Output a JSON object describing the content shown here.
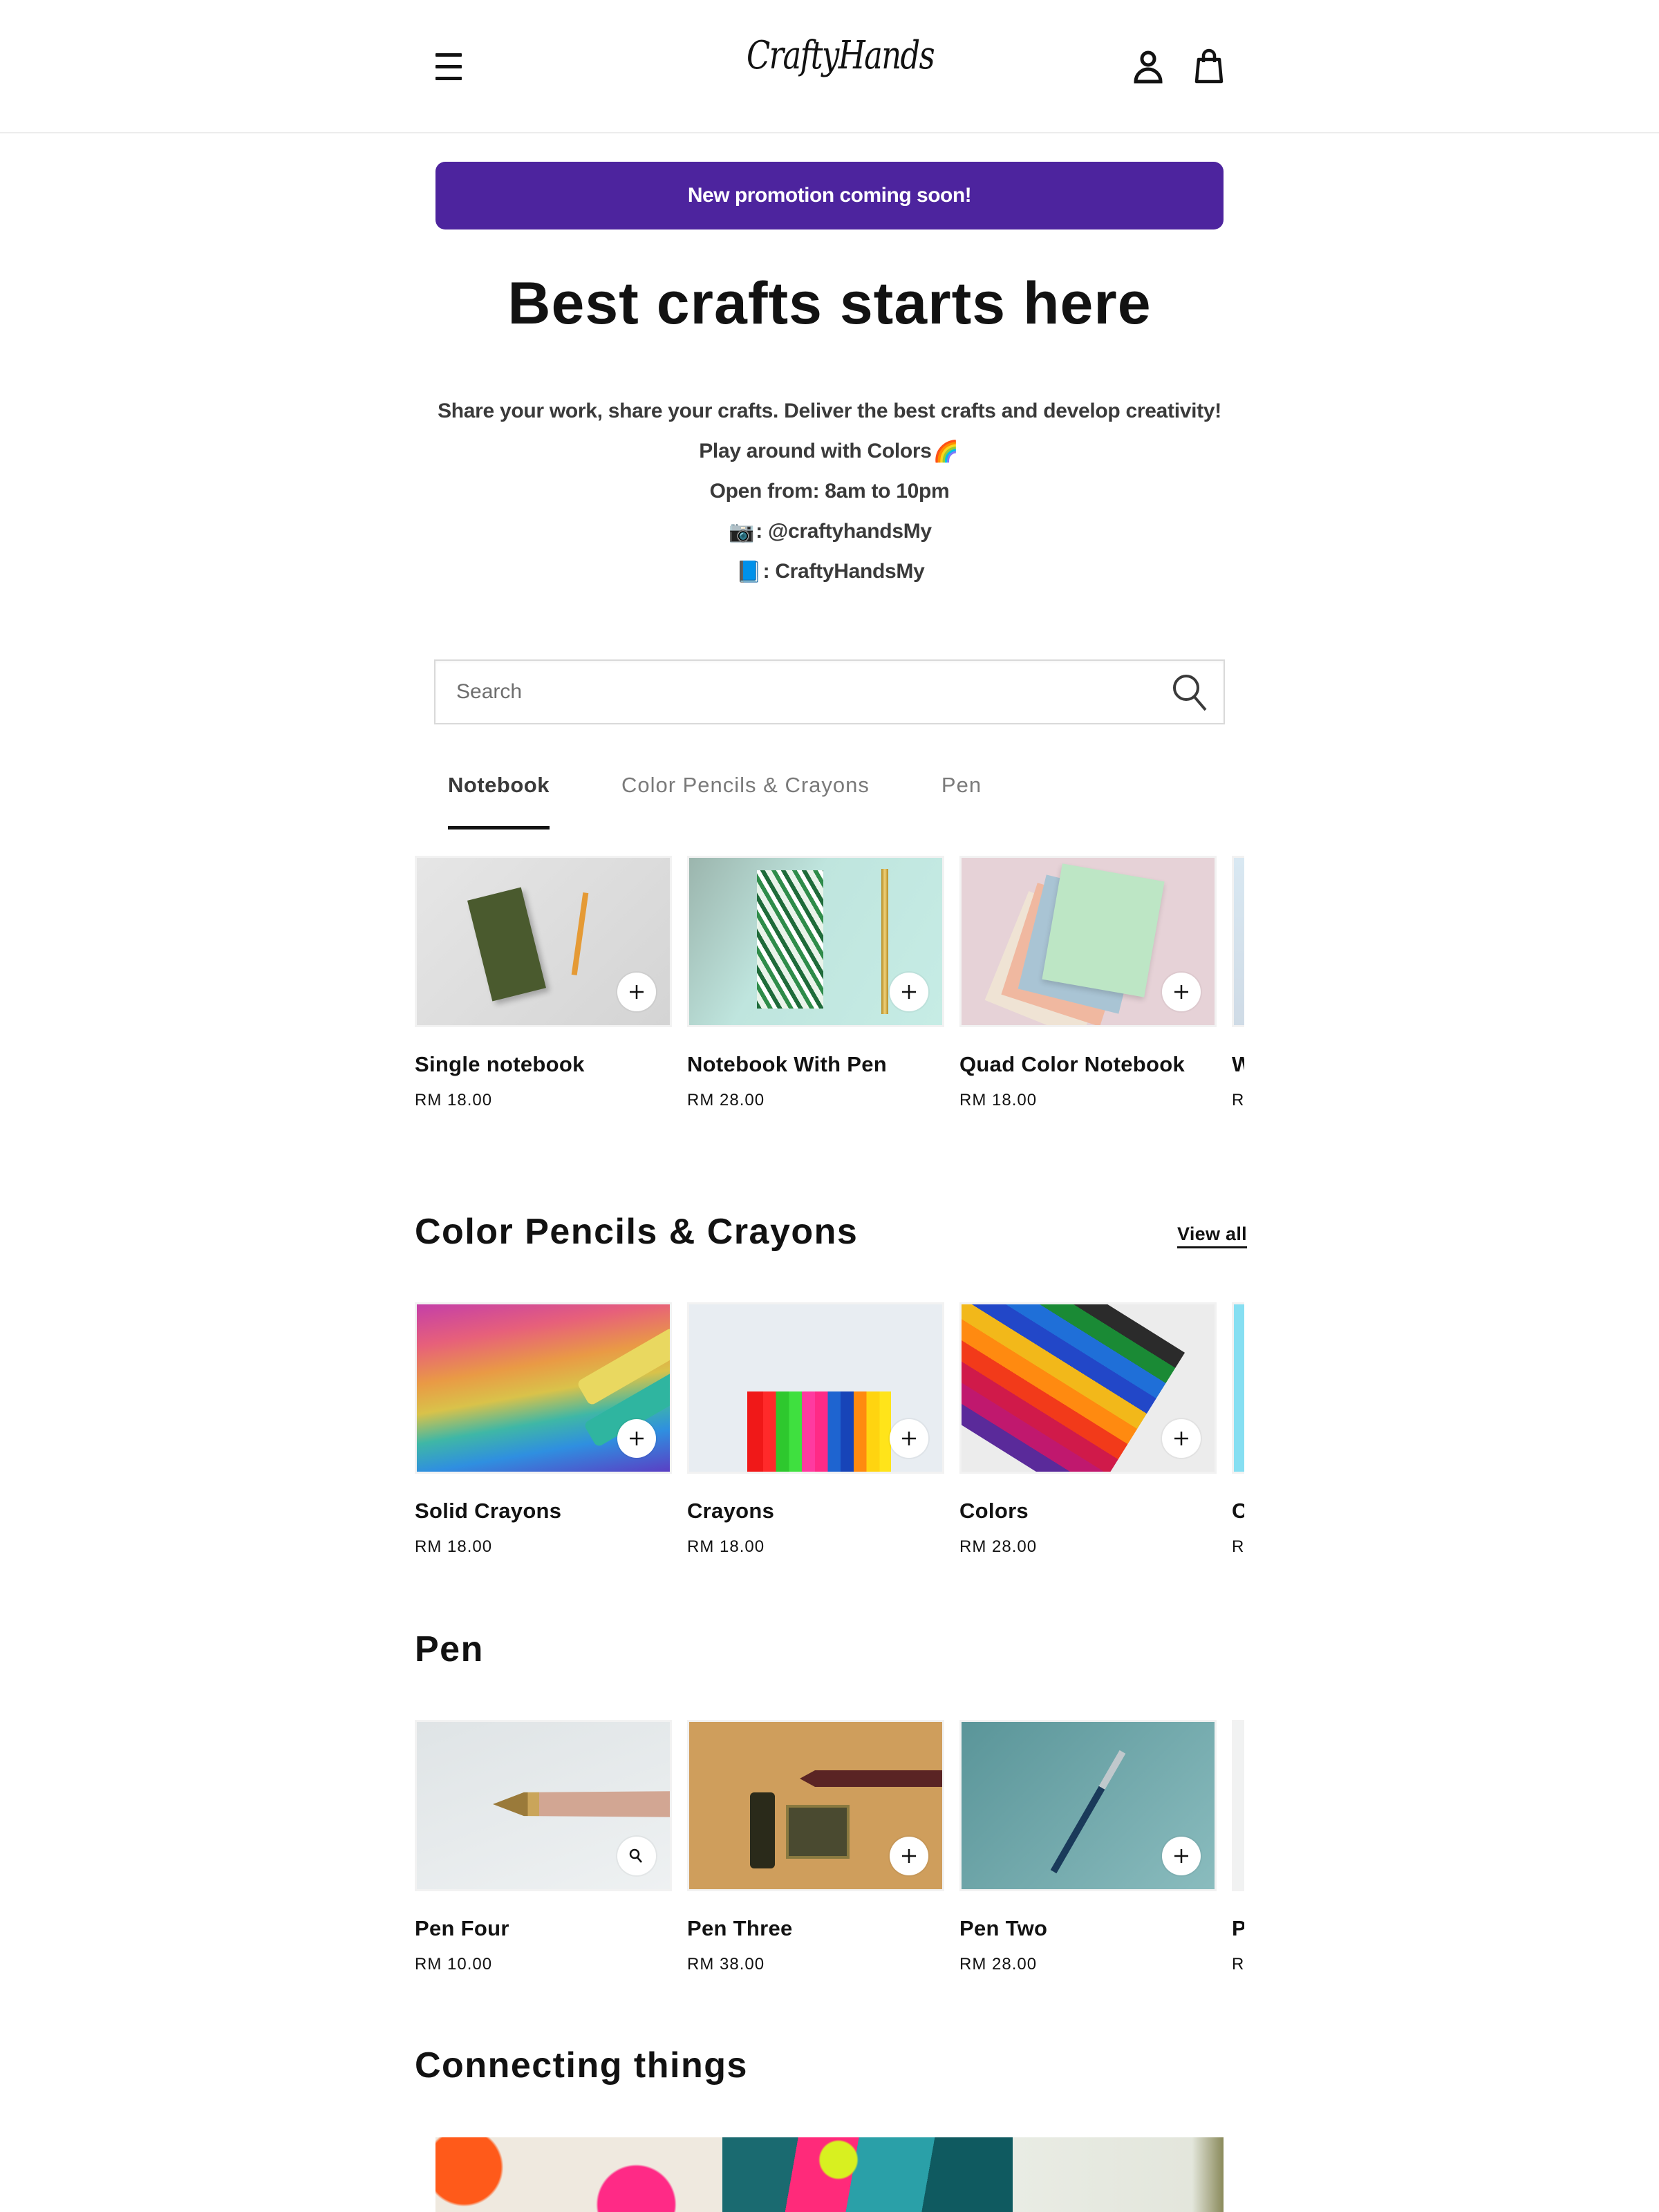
{
  "header": {
    "logo": "CraftyHands",
    "icons": [
      "menu-icon",
      "account-icon",
      "cart-icon"
    ]
  },
  "promo": {
    "text": "New promotion coming soon!",
    "color": "#4d249e"
  },
  "hero": {
    "title": "Best crafts starts here",
    "lines": [
      "Share your work, share your crafts. Deliver the best crafts and develop creativity!",
      "Play around with Colors",
      "Open from: 8am to 10pm",
      ": @craftyhandsMy",
      ": CraftyHandsMy"
    ],
    "emoji": {
      "rainbow": "🌈",
      "camera": "📷",
      "book": "📘"
    }
  },
  "search": {
    "placeholder": "Search",
    "value": ""
  },
  "tabs": [
    {
      "label": "Notebook",
      "active": true
    },
    {
      "label": "Color Pencils & Crayons",
      "active": false
    },
    {
      "label": "Pen",
      "active": false
    }
  ],
  "notebook": {
    "products": [
      {
        "title": "Single notebook",
        "price": "RM 18.00",
        "action": "add"
      },
      {
        "title": "Notebook With Pen",
        "price": "RM 28.00",
        "action": "add"
      },
      {
        "title": "Quad Color Notebook",
        "price": "RM 18.00",
        "action": "add"
      },
      {
        "title": "W",
        "price": "RI",
        "action": "add"
      }
    ]
  },
  "crayons": {
    "title": "Color Pencils & Crayons",
    "view_all": "View all",
    "products": [
      {
        "title": "Solid Crayons",
        "price": "RM 18.00",
        "action": "add"
      },
      {
        "title": "Crayons",
        "price": "RM 18.00",
        "action": "add"
      },
      {
        "title": "Colors",
        "price": "RM 28.00",
        "action": "add"
      },
      {
        "title": "C",
        "price": "RI",
        "action": "add"
      }
    ]
  },
  "pen": {
    "title": "Pen",
    "products": [
      {
        "title": "Pen Four",
        "price": "RM 10.00",
        "action": "view"
      },
      {
        "title": "Pen Three",
        "price": "RM 38.00",
        "action": "add"
      },
      {
        "title": "Pen Two",
        "price": "RM 28.00",
        "action": "add"
      },
      {
        "title": "P",
        "price": "RI",
        "action": "add"
      }
    ]
  },
  "connecting": {
    "title": "Connecting things"
  }
}
